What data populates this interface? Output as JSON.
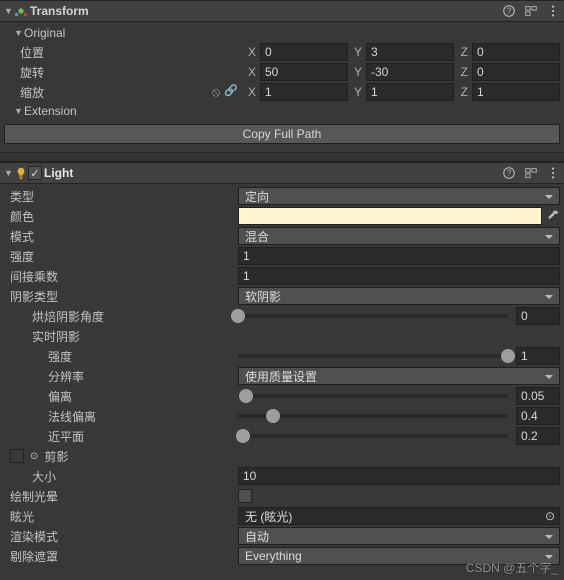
{
  "transform": {
    "title": "Transform",
    "original": "Original",
    "extension": "Extension",
    "position_label": "位置",
    "rotation_label": "旋转",
    "scale_label": "缩放",
    "axis_x": "X",
    "axis_y": "Y",
    "axis_z": "Z",
    "pos": {
      "x": "0",
      "y": "3",
      "z": "0"
    },
    "rot": {
      "x": "50",
      "y": "-30",
      "z": "0"
    },
    "scale": {
      "x": "1",
      "y": "1",
      "z": "1"
    },
    "copy_path": "Copy Full Path"
  },
  "light": {
    "title": "Light",
    "type_label": "类型",
    "type_value": "定向",
    "color_label": "颜色",
    "color_value": "#FFF4CE",
    "mode_label": "模式",
    "mode_value": "混合",
    "intensity_label": "强度",
    "intensity_value": "1",
    "indirect_label": "间接乘数",
    "indirect_value": "1",
    "shadow_type_label": "阴影类型",
    "shadow_type_value": "软阴影",
    "baked_angle_label": "烘焙阴影角度",
    "baked_angle_value": "0",
    "realtime_label": "实时阴影",
    "strength_label": "强度",
    "strength_value": "1",
    "resolution_label": "分辨率",
    "resolution_value": "使用质量设置",
    "bias_label": "偏离",
    "bias_value": "0.05",
    "normal_bias_label": "法线偏离",
    "normal_bias_value": "0.4",
    "near_plane_label": "近平面",
    "near_plane_value": "0.2",
    "cookie_label": "剪影",
    "size_label": "大小",
    "size_value": "10",
    "halo_label": "绘制光晕",
    "flare_label": "眩光",
    "flare_value": "无 (眩光)",
    "render_mode_label": "渲染模式",
    "render_mode_value": "自动",
    "culling_label": "剔除遮罩",
    "culling_value": "Everything"
  },
  "watermark": "CSDN @五个字_"
}
